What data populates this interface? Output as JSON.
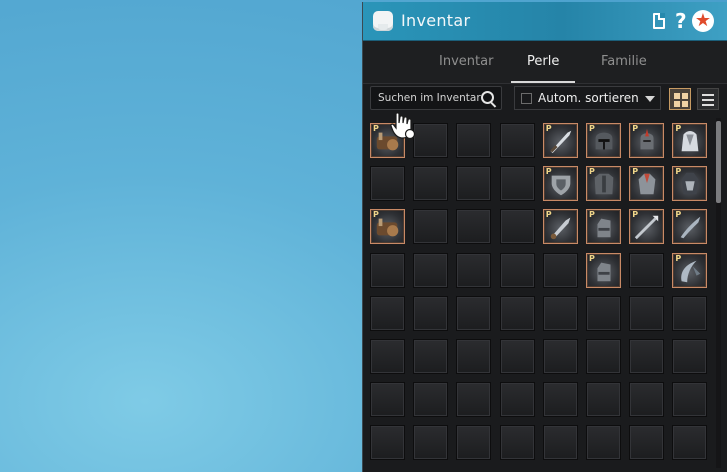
{
  "window": {
    "title": "Inventar",
    "help_glyph": "?",
    "favorite_glyph": "★"
  },
  "tabs": [
    {
      "label": "Inventar",
      "active": false
    },
    {
      "label": "Perle",
      "active": true
    },
    {
      "label": "Familie",
      "active": false
    }
  ],
  "toolbar": {
    "search_placeholder": "Suchen im Inventar",
    "sort_label": "Autom. sortieren",
    "sort_checked": false,
    "view_mode": "grid"
  },
  "grid": {
    "columns": 8,
    "item_tag": "P",
    "rows": [
      [
        "horse-gear",
        "",
        "",
        "",
        "sword",
        "helmet",
        "red-helmet",
        "white-armor"
      ],
      [
        "",
        "",
        "",
        "",
        "shield",
        "chest-armor",
        "armor-suit",
        "dark-armor"
      ],
      [
        "horse-gear",
        "",
        "",
        "",
        "short-sword",
        "gauntlet",
        "spear",
        "blade"
      ],
      [
        "",
        "",
        "",
        "",
        "",
        "gauntlet",
        "",
        "curved-blade"
      ],
      [
        "",
        "",
        "",
        "",
        "",
        "",
        "",
        ""
      ],
      [
        "",
        "",
        "",
        "",
        "",
        "",
        "",
        ""
      ],
      [
        "",
        "",
        "",
        "",
        "",
        "",
        "",
        ""
      ],
      [
        "",
        "",
        "",
        "",
        "",
        "",
        "",
        ""
      ]
    ]
  },
  "colors": {
    "titlebar": "#2a95b9",
    "panel_bg": "#1a1b1d",
    "item_border": "#c98a66",
    "active_view_border": "#c79b63"
  }
}
